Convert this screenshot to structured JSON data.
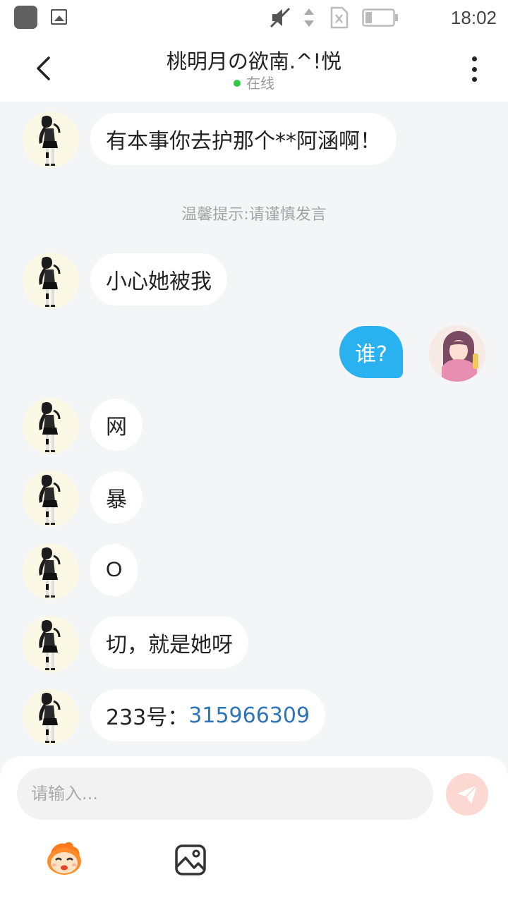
{
  "status_bar": {
    "time": "18:02",
    "icons": [
      "app-icon",
      "image-notification-icon",
      "mute-icon",
      "data-arrows-icon",
      "no-sim-icon",
      "battery-icon"
    ]
  },
  "header": {
    "back_icon": "chevron-left-icon",
    "title": "桃明月の欲南.^!悦",
    "status": "在线",
    "more_icon": "more-vertical-icon"
  },
  "messages": [
    {
      "side": "left",
      "text": "有本事你去护那个**阿涵啊！"
    },
    {
      "side": "left",
      "text": "小心她被我"
    },
    {
      "side": "right",
      "text": "谁?"
    },
    {
      "side": "left",
      "text": "网"
    },
    {
      "side": "left",
      "text": "暴"
    },
    {
      "side": "left",
      "text": "O"
    },
    {
      "side": "left",
      "text": "切，就是她呀"
    },
    {
      "side": "left",
      "text_prefix": "233号：",
      "link": "315966309"
    }
  ],
  "tip": "温馨提示:请谨慎发言",
  "composer": {
    "placeholder": "请输入...",
    "send_icon": "send-icon",
    "emoji_icon": "emoji-face-icon",
    "image_icon": "image-icon"
  },
  "colors": {
    "my_bubble": "#2ab2f0",
    "online_dot": "#2ecc40",
    "link": "#2d74b8",
    "send_button": "#fbd9d2"
  }
}
